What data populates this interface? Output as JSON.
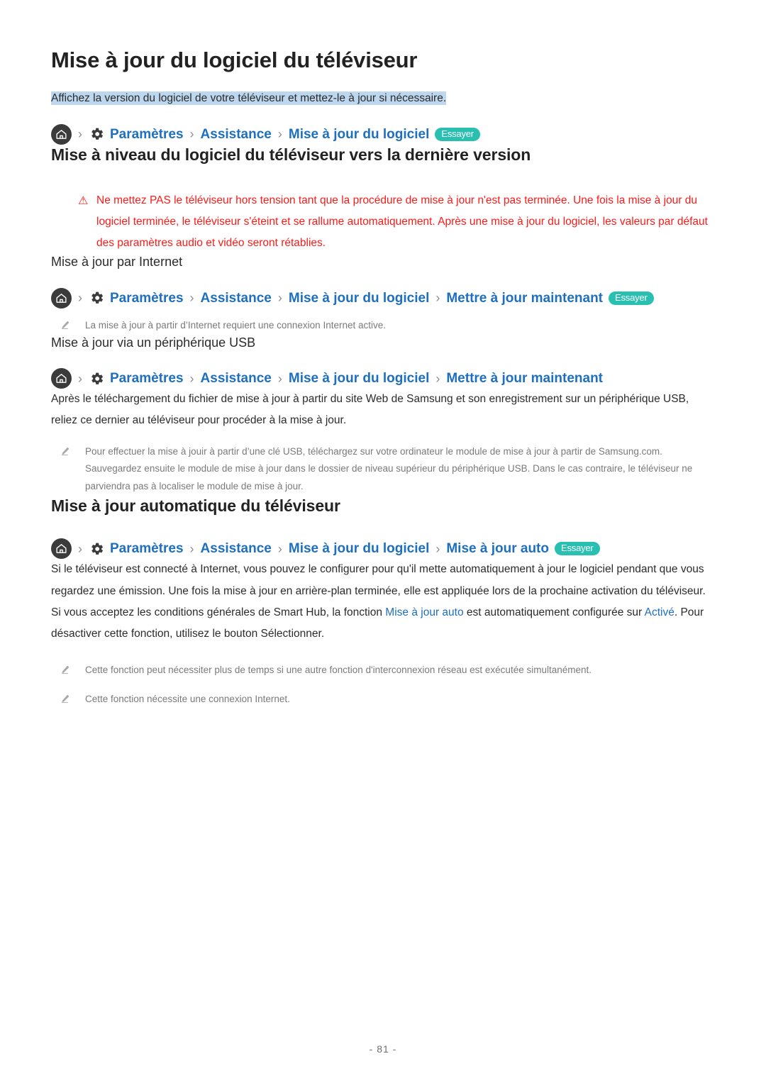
{
  "document": {
    "title": "Mise à jour du logiciel du téléviseur",
    "intro": "Affichez la version du logiciel de votre téléviseur et mettez-le à jour si nécessaire.",
    "page_number": "- 81 -"
  },
  "colors": {
    "link_blue": "#1F6FC0",
    "badge_teal": "#29BFB1",
    "warning_red": "#FF1A17",
    "highlight_blue": "#BCD7EE",
    "note_gray": "#7A7A7A",
    "icon_dark": "#3B3B3B"
  },
  "breadcrumbs": {
    "top": {
      "home_icon": "home-icon",
      "gear_icon": "gear-icon",
      "separator": "›",
      "items": [
        "Paramètres",
        "Assistance",
        "Mise à jour du logiciel"
      ],
      "badge": "Essayer"
    },
    "internet": {
      "home_icon": "home-icon",
      "gear_icon": "gear-icon",
      "separator": "›",
      "items": [
        "Paramètres",
        "Assistance",
        "Mise à jour du logiciel",
        "Mettre à jour maintenant"
      ],
      "badge": "Essayer"
    },
    "usb": {
      "home_icon": "home-icon",
      "gear_icon": "gear-icon",
      "separator": "›",
      "items": [
        "Paramètres",
        "Assistance",
        "Mise à jour du logiciel",
        "Mettre à jour maintenant"
      ],
      "badge": ""
    },
    "auto": {
      "home_icon": "home-icon",
      "gear_icon": "gear-icon",
      "separator": "›",
      "items": [
        "Paramètres",
        "Assistance",
        "Mise à jour du logiciel",
        "Mise à jour auto"
      ],
      "badge": "Essayer"
    }
  },
  "sections": {
    "upgrade": {
      "title": "Mise à niveau du logiciel du téléviseur vers la dernière version",
      "warning_icon": "⚠",
      "warning": "Ne mettez PAS le téléviseur hors tension tant que la procédure de mise à jour n'est pas terminée. Une fois la mise à jour du logiciel terminée, le téléviseur s'éteint et se rallume automatiquement. Après une mise à jour du logiciel, les valeurs par défaut des paramètres audio et vidéo seront rétablies."
    },
    "internet": {
      "title": "Mise à jour par Internet",
      "note": "La mise à jour à partir d’Internet requiert une connexion Internet active."
    },
    "usb": {
      "title": "Mise à jour via un périphérique USB",
      "body": "Après le téléchargement du fichier de mise à jour à partir du site Web de Samsung et son enregistrement sur un périphérique USB, reliez ce dernier au téléviseur pour procéder à la mise à jour.",
      "note": "Pour effectuer la mise à jouir à partir d’une clé USB, téléchargez sur votre ordinateur le module de mise à jour à partir de Samsung.com. Sauvegardez ensuite le module de mise à jour dans le dossier de niveau supérieur du périphérique USB. Dans le cas contraire, le téléviseur ne parviendra pas à localiser le module de mise à jour."
    },
    "auto": {
      "title": "Mise à jour automatique du téléviseur",
      "body1": "Si le téléviseur est connecté à Internet, vous pouvez le configurer pour qu'il mette automatiquement à jour le logiciel pendant que vous regardez une émission. Une fois la mise à jour en arrière-plan terminée, elle est appliquée lors de la prochaine activation du téléviseur.",
      "body2_part1": "Si vous acceptez les conditions générales de Smart Hub, la fonction ",
      "body2_link1": "Mise à jour auto",
      "body2_part2": " est automatiquement configurée sur ",
      "body2_link2": "Activé",
      "body2_part3": ". Pour désactiver cette fonction, utilisez le bouton Sélectionner.",
      "note1": "Cette fonction peut nécessiter plus de temps si une autre fonction d'interconnexion réseau est exécutée simultanément.",
      "note2": "Cette fonction nécessite une connexion Internet."
    }
  }
}
